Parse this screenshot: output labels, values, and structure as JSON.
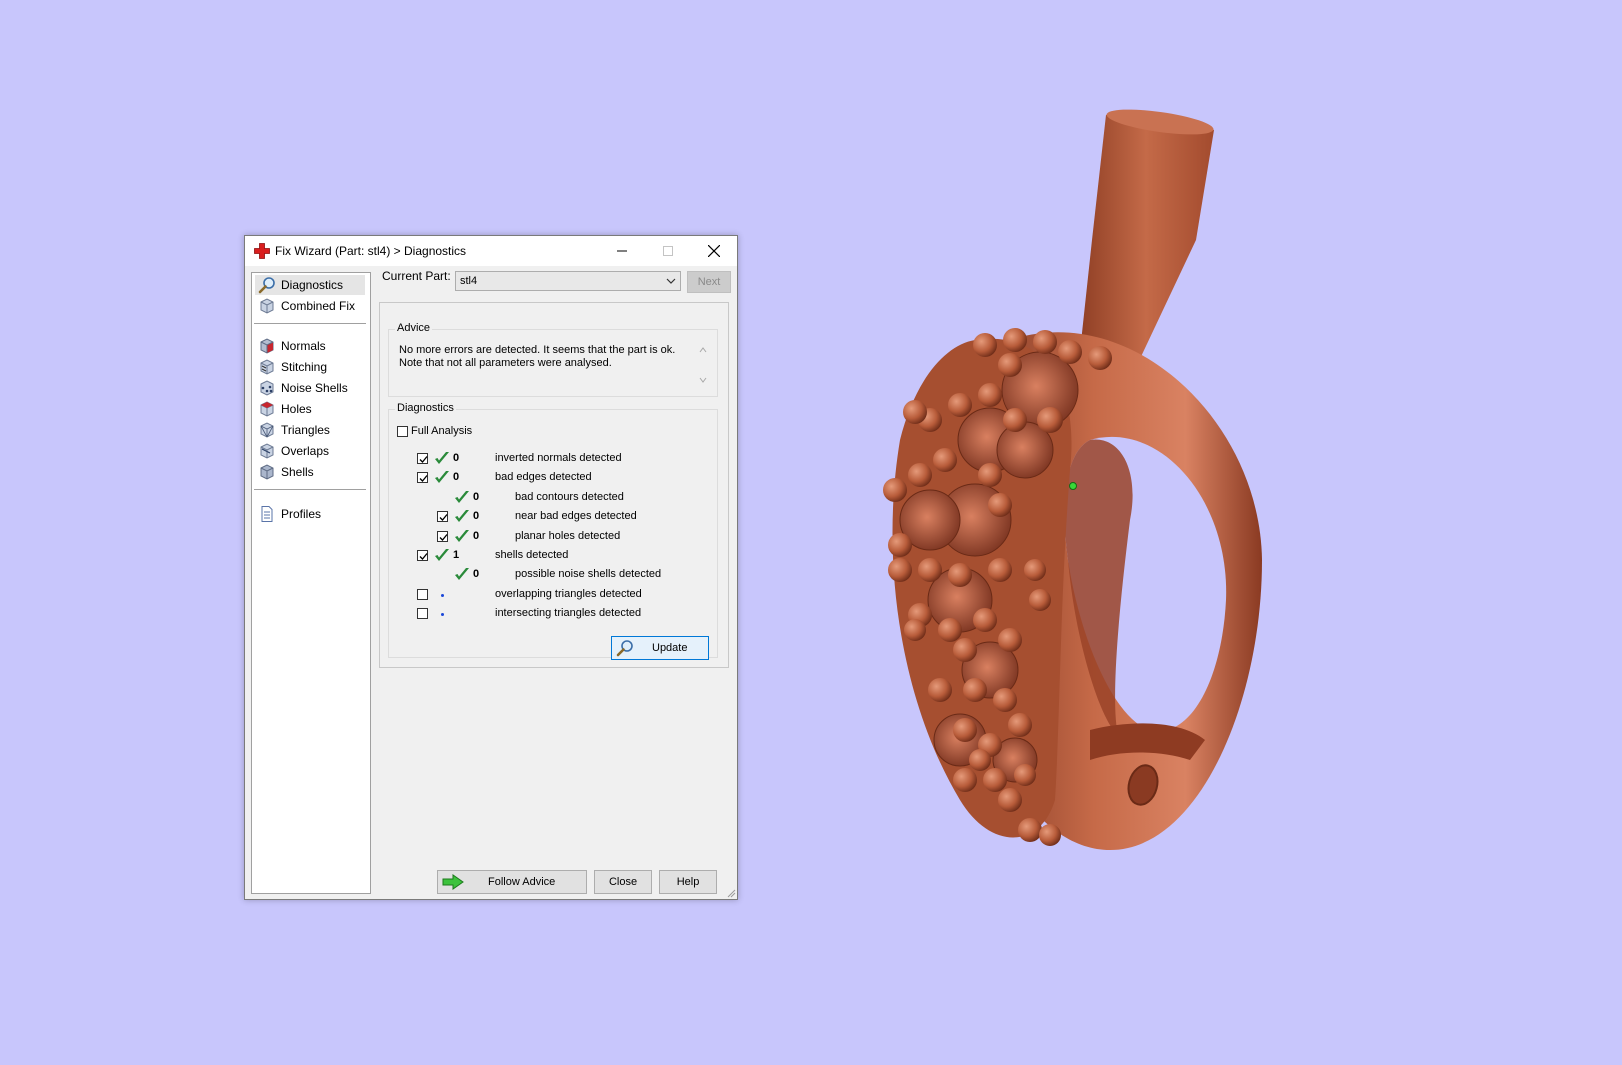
{
  "window": {
    "title": "Fix Wizard (Part: stl4) > Diagnostics"
  },
  "nav": {
    "items": [
      {
        "label": "Diagnostics",
        "icon": "magnifier-icon",
        "selected": true
      },
      {
        "label": "Combined Fix",
        "icon": "cube-icon"
      },
      {
        "label": "Normals",
        "icon": "normals-cube-icon"
      },
      {
        "label": "Stitching",
        "icon": "stitching-cube-icon"
      },
      {
        "label": "Noise Shells",
        "icon": "noise-shells-icon"
      },
      {
        "label": "Holes",
        "icon": "holes-cube-icon"
      },
      {
        "label": "Triangles",
        "icon": "triangles-cube-icon"
      },
      {
        "label": "Overlaps",
        "icon": "overlaps-cube-icon"
      },
      {
        "label": "Shells",
        "icon": "shells-cube-icon"
      },
      {
        "label": "Profiles",
        "icon": "document-icon"
      }
    ]
  },
  "top": {
    "current_part_label": "Current Part:",
    "current_part_value": "stl4",
    "next_label": "Next"
  },
  "advice": {
    "title": "Advice",
    "text_line1": "No more errors are detected. It seems that the part is ok.",
    "text_line2": "Note that not all parameters were analysed."
  },
  "diagnostics": {
    "title": "Diagnostics",
    "full_analysis_label": "Full Analysis",
    "full_analysis_checked": false,
    "rows": [
      {
        "checkbox": true,
        "checked": true,
        "status": "ok",
        "count": "0",
        "label": "inverted normals detected"
      },
      {
        "checkbox": true,
        "checked": true,
        "status": "ok",
        "count": "0",
        "label": "bad edges detected"
      },
      {
        "checkbox": false,
        "checked": false,
        "status": "ok",
        "count": "0",
        "label": "bad contours detected",
        "indent": true
      },
      {
        "checkbox": true,
        "checked": true,
        "status": "ok",
        "count": "0",
        "label": "near bad edges detected",
        "indent": true
      },
      {
        "checkbox": true,
        "checked": true,
        "status": "ok",
        "count": "0",
        "label": "planar holes detected",
        "indent": true
      },
      {
        "checkbox": true,
        "checked": true,
        "status": "ok",
        "count": "1",
        "label": "shells detected"
      },
      {
        "checkbox": false,
        "checked": false,
        "status": "ok",
        "count": "0",
        "label": "possible noise shells detected",
        "indent": true
      },
      {
        "checkbox": true,
        "checked": false,
        "status": "unknown",
        "count": "",
        "label": "overlapping triangles detected"
      },
      {
        "checkbox": true,
        "checked": false,
        "status": "unknown",
        "count": "",
        "label": "intersecting triangles detected"
      }
    ],
    "update_label": "Update"
  },
  "buttons": {
    "follow_advice": "Follow Advice",
    "close": "Close",
    "help": "Help"
  },
  "colors": {
    "background": "#c8c6fc",
    "model": "#b8603f",
    "ok_tick": "#2a8a3a",
    "accent": "#0078d7"
  }
}
